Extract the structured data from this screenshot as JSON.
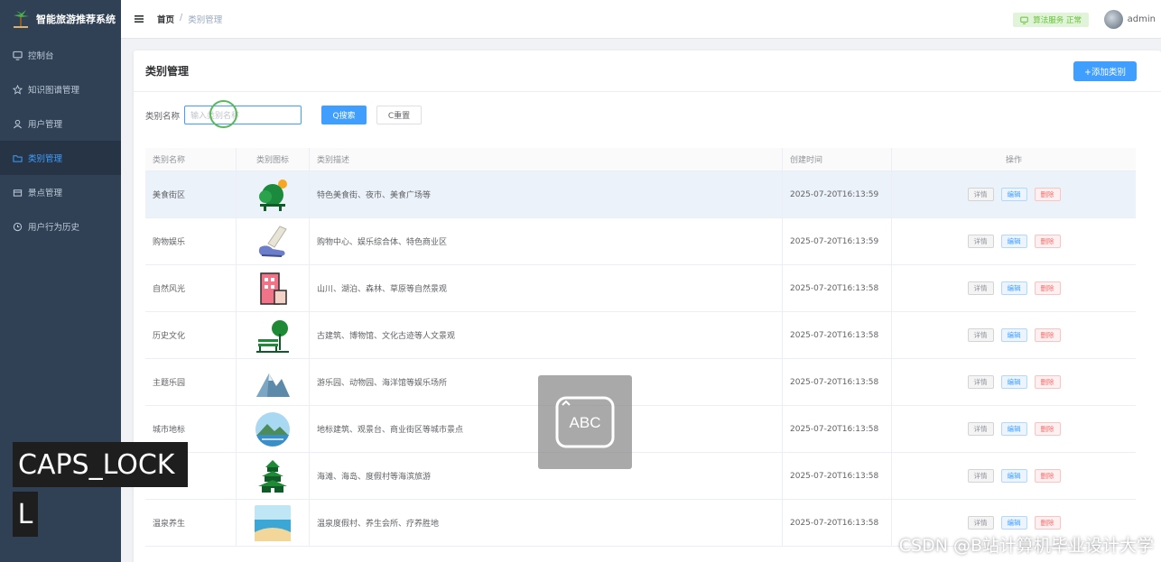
{
  "app": {
    "title": "智能旅游推荐系统"
  },
  "sidebar": {
    "items": [
      {
        "label": "控制台",
        "icon": "monitor-icon"
      },
      {
        "label": "知识图谱管理",
        "icon": "star-icon"
      },
      {
        "label": "用户管理",
        "icon": "user-icon"
      },
      {
        "label": "类别管理",
        "icon": "folder-icon",
        "active": true
      },
      {
        "label": "景点管理",
        "icon": "box-icon"
      },
      {
        "label": "用户行为历史",
        "icon": "clock-icon"
      }
    ]
  },
  "header": {
    "breadcrumb": [
      "首页",
      "/",
      "类别管理"
    ],
    "status": "算法服务 正常",
    "user": "admin"
  },
  "main": {
    "title": "类别管理",
    "add_label": "+添加类别",
    "filter": {
      "label": "类别名称",
      "placeholder": "输入类别名称",
      "search_label": "Q搜索",
      "reset_label": "C重置"
    },
    "columns": [
      "类别名称",
      "类别图标",
      "类别描述",
      "创建时间",
      "操作"
    ],
    "actions": {
      "detail": "详情",
      "edit": "编辑",
      "delete": "删除"
    },
    "rows": [
      {
        "name": "美食街区",
        "icon": "trees-sun-icon",
        "desc": "特色美食街、夜市、美食广场等",
        "time": "2025-07-20T16:13:59"
      },
      {
        "name": "购物娱乐",
        "icon": "shoe-icon",
        "desc": "购物中心、娱乐综合体、特色商业区",
        "time": "2025-07-20T16:13:59"
      },
      {
        "name": "自然风光",
        "icon": "building-icon",
        "desc": "山川、湖泊、森林、草原等自然景观",
        "time": "2025-07-20T16:13:58"
      },
      {
        "name": "历史文化",
        "icon": "bench-tree-icon",
        "desc": "古建筑、博物馆、文化古迹等人文景观",
        "time": "2025-07-20T16:13:58"
      },
      {
        "name": "主题乐园",
        "icon": "mountain-icon",
        "desc": "游乐园、动物园、海洋馆等娱乐场所",
        "time": "2025-07-20T16:13:58"
      },
      {
        "name": "城市地标",
        "icon": "landscape-circle-icon",
        "desc": "地标建筑、观景台、商业街区等城市景点",
        "time": "2025-07-20T16:13:58"
      },
      {
        "name": "",
        "icon": "pagoda-icon",
        "desc": "海滩、海岛、度假村等海滨旅游",
        "time": "2025-07-20T16:13:58"
      },
      {
        "name": "温泉养生",
        "icon": "beach-icon",
        "desc": "温泉度假村、养生会所、疗养胜地",
        "time": "2025-07-20T16:13:58"
      }
    ]
  },
  "overlay": {
    "caps": "CAPS_LOCK",
    "caps_key": "L",
    "abc": "ABC",
    "watermark": "CSDN @B站计算机毕业设计大学"
  }
}
